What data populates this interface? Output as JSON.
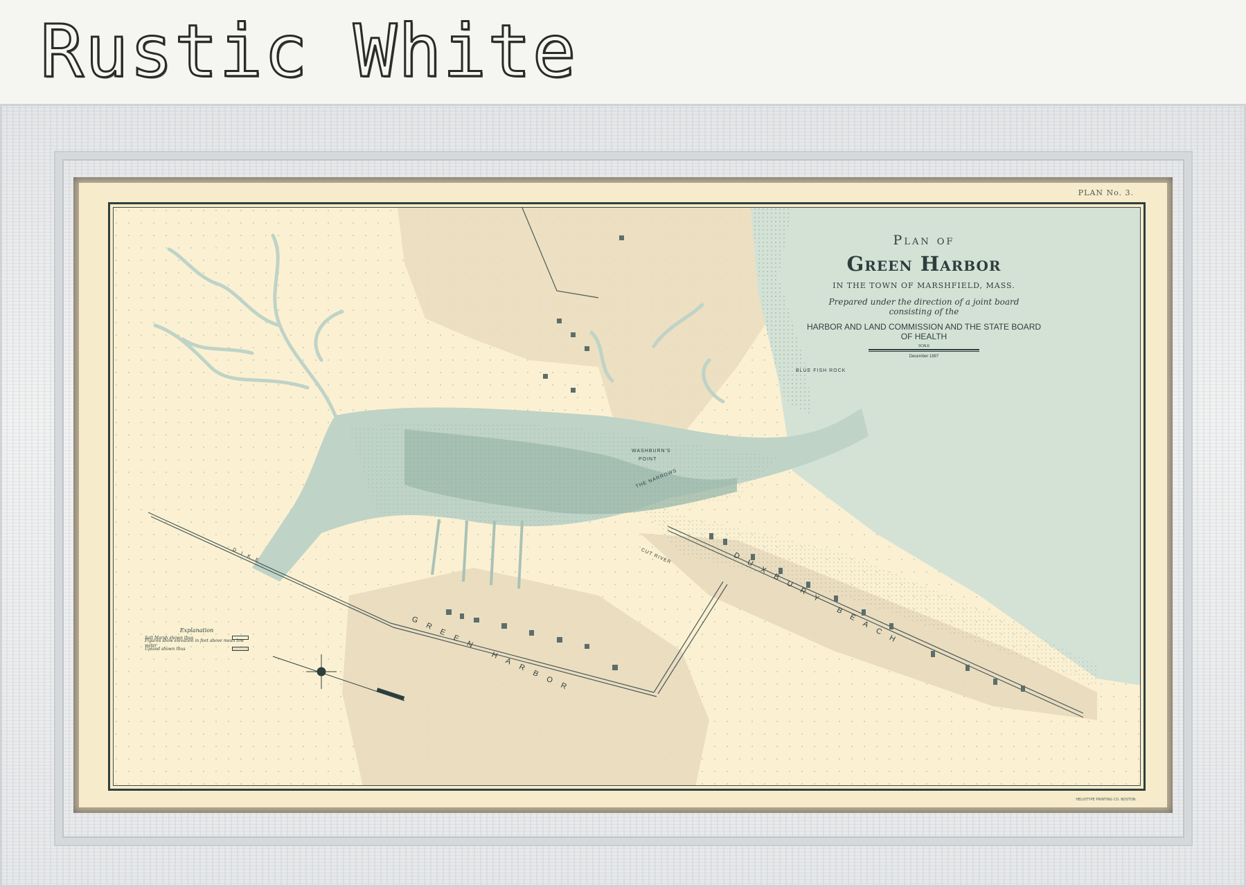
{
  "header": {
    "frame_title": "Rustic White"
  },
  "print": {
    "plan_number": "PLAN No. 3.",
    "printer": "HELIOTYPE PRINTING CO. BOSTON."
  },
  "map": {
    "title_line1": "Plan of",
    "title_line2": "Green Harbor",
    "title_line3": "IN THE TOWN OF MARSHFIELD, MASS.",
    "prepared": "Prepared under the direction of a joint board consisting of the",
    "commission": "HARBOR AND LAND COMMISSION AND THE STATE BOARD OF HEALTH",
    "scale_label": "SCALE",
    "date": "December 1897",
    "labels": {
      "washburns_point": "WASHBURN'S",
      "point": "POINT",
      "narrows": "THE NARROWS",
      "cut_river": "CUT    RIVER",
      "duxbury_beach": "DUXBURY BEACH",
      "green_harbor": "GREEN HARBOR",
      "dike": "DIKE",
      "fish_rock": "BLUE FISH ROCK"
    },
    "explanation": {
      "title": "Explanation",
      "rows": [
        "Salt Marsh shown thus",
        "Figures show elevation in feet above mean low water",
        "Upland shown thus"
      ]
    }
  },
  "colors": {
    "water": "#d7e4d6",
    "deep_water": "#9fbcae",
    "upland": "#e9dcc0",
    "paper": "#fbf1d2",
    "ink": "#2d3f3d"
  }
}
